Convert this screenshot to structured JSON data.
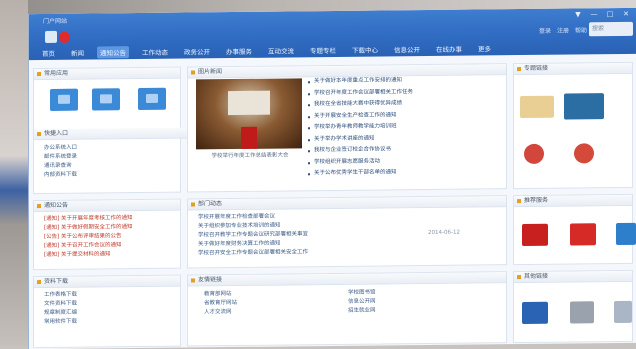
{
  "window": {
    "app_title": "门户网站"
  },
  "header": {
    "user_links": [
      "登录",
      "注册",
      "帮助"
    ],
    "search_placeholder": "搜索",
    "controls": [
      "▼",
      "—",
      "□",
      "✕"
    ]
  },
  "nav": {
    "items": [
      "首页",
      "新闻",
      "通知公告",
      "工作动态",
      "政务公开",
      "办事服务",
      "互动交流",
      "专题专栏",
      "下载中心",
      "信息公开",
      "在线办事",
      "更多"
    ],
    "active_index": 2
  },
  "panels": {
    "apps": {
      "title": "常用应用"
    },
    "quick": {
      "title": "快捷入口",
      "items": [
        "办公系统入口",
        "邮件系统登录",
        "通讯录查询",
        "内部资料下载"
      ]
    },
    "news": {
      "title": "图片新闻",
      "caption": "学校举行年度工作总结表彰大会",
      "items": [
        "关于做好本年度重点工作安排的通知",
        "学校召开年度工作会议部署相关工作任务",
        "我校在全省技能大赛中获得优异成绩",
        "关于开展安全生产检查工作的通知",
        "学校举办青年教师教学能力培训班",
        "关于举办学术讲座的通知",
        "我校与企业签订校企合作协议书",
        "学校组织开展志愿服务活动",
        "关于公布优秀学生干部名单的通知"
      ]
    },
    "ads1": {
      "title": "专题链接"
    },
    "notices": {
      "title": "通知公告",
      "items": [
        "[通知] 关于开展年度考核工作的通知",
        "[通知] 关于做好假期安全工作的通知",
        "[公告] 关于公布评审结果的公告",
        "[通知] 关于召开工作会议的通知",
        "[通知] 关于提交材料的通知"
      ]
    },
    "dept": {
      "title": "部门动态",
      "items": [
        "学校开展年度工作检查部署会议",
        "关于组织参加专业技术培训的通知",
        "学校召开教学工作专题会议研究部署相关事宜",
        "关于做好年度财务决算工作的通知",
        "学校召开安全工作专题会议部署相关安全工作"
      ],
      "date": "2014-06-12"
    },
    "ads2": {
      "title": "推荐服务"
    },
    "downloads": {
      "title": "资料下载",
      "items": [
        "工作表格下载",
        "文件资料下载",
        "规章制度汇编",
        "常用软件下载"
      ]
    },
    "links": {
      "title": "友情链接",
      "col1": [
        "教育部网站",
        "省教育厅网站",
        "人才交流网"
      ],
      "col2": [
        "学校图书馆",
        "信息公开网",
        "招生就业网"
      ]
    },
    "ads3": {
      "title": "其他链接"
    }
  },
  "colors": {
    "titlebar": "#2f6bc1",
    "accent": "#3b8ad8",
    "link": "#3c5b86",
    "notice_red": "#c0392b"
  }
}
